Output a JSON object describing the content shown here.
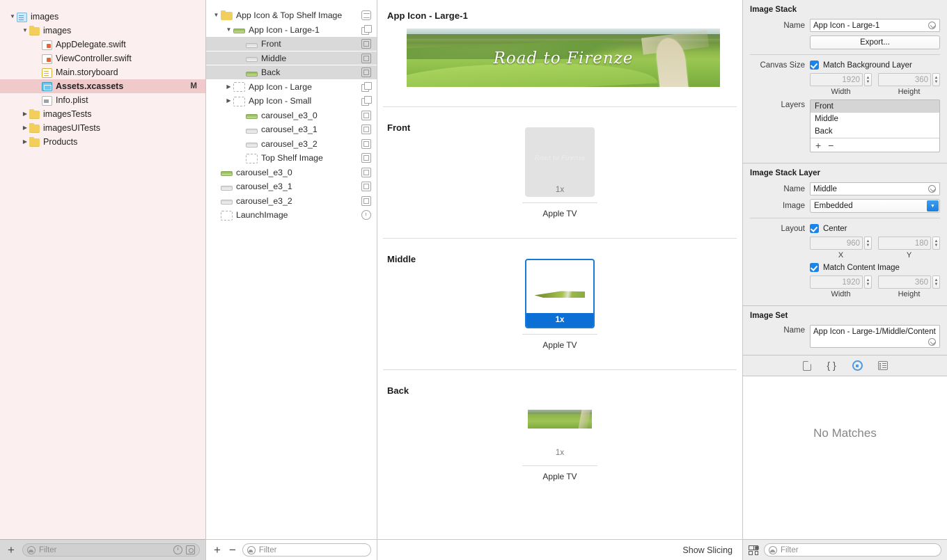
{
  "navigator": {
    "items": [
      {
        "label": "images",
        "indent": 0,
        "disc": "open",
        "icon": "project-icon",
        "selected": false,
        "status": ""
      },
      {
        "label": "images",
        "indent": 1,
        "disc": "open",
        "icon": "folder-icon",
        "selected": false,
        "status": ""
      },
      {
        "label": "AppDelegate.swift",
        "indent": 2,
        "disc": "none",
        "icon": "swift-file-icon",
        "selected": false,
        "status": ""
      },
      {
        "label": "ViewController.swift",
        "indent": 2,
        "disc": "none",
        "icon": "swift-file-icon",
        "selected": false,
        "status": ""
      },
      {
        "label": "Main.storyboard",
        "indent": 2,
        "disc": "none",
        "icon": "storyboard-icon",
        "selected": false,
        "status": ""
      },
      {
        "label": "Assets.xcassets",
        "indent": 2,
        "disc": "none",
        "icon": "assets-icon",
        "selected": true,
        "status": "M"
      },
      {
        "label": "Info.plist",
        "indent": 2,
        "disc": "none",
        "icon": "plist-icon",
        "selected": false,
        "status": ""
      },
      {
        "label": "imagesTests",
        "indent": 1,
        "disc": "closed",
        "icon": "folder-icon",
        "selected": false,
        "status": ""
      },
      {
        "label": "imagesUITests",
        "indent": 1,
        "disc": "closed",
        "icon": "folder-icon",
        "selected": false,
        "status": ""
      },
      {
        "label": "Products",
        "indent": 1,
        "disc": "closed",
        "icon": "folder-icon",
        "selected": false,
        "status": ""
      }
    ],
    "bottom": {
      "add_label": "+",
      "filter_placeholder": "Filter",
      "recent_icon": "clock-icon",
      "focus_icon": "focus-icon"
    }
  },
  "asset_list": {
    "items": [
      {
        "label": "App Icon & Top Shelf Image",
        "indent": 0,
        "disc": "open",
        "thumb": "folder",
        "badge": "globe-badge-icon",
        "selected": false
      },
      {
        "label": "App Icon - Large-1",
        "indent": 1,
        "disc": "open",
        "thumb": "strip-green",
        "badge": "stack-badge-icon",
        "selected": false
      },
      {
        "label": "Front",
        "indent": 2,
        "disc": "none",
        "thumb": "strip-gray",
        "badge": "square-badge-icon",
        "selected": true
      },
      {
        "label": "Middle",
        "indent": 2,
        "disc": "none",
        "thumb": "strip-gray",
        "badge": "square-badge-icon",
        "selected": true
      },
      {
        "label": "Back",
        "indent": 2,
        "disc": "none",
        "thumb": "strip-green",
        "badge": "square-badge-icon",
        "selected": true
      },
      {
        "label": "App Icon - Large",
        "indent": 1,
        "disc": "closed",
        "thumb": "dashed",
        "badge": "stack-badge-icon",
        "selected": false
      },
      {
        "label": "App Icon - Small",
        "indent": 1,
        "disc": "closed",
        "thumb": "dashed",
        "badge": "stack-badge-icon",
        "selected": false
      },
      {
        "label": "carousel_e3_0",
        "indent": 2,
        "disc": "none",
        "thumb": "strip-green",
        "badge": "square-badge-icon",
        "selected": false
      },
      {
        "label": "carousel_e3_1",
        "indent": 2,
        "disc": "none",
        "thumb": "strip-gray",
        "badge": "square-badge-icon",
        "selected": false
      },
      {
        "label": "carousel_e3_2",
        "indent": 2,
        "disc": "none",
        "thumb": "strip-gray",
        "badge": "square-badge-icon",
        "selected": false
      },
      {
        "label": "Top Shelf Image",
        "indent": 2,
        "disc": "none",
        "thumb": "dashed",
        "badge": "square-badge-icon",
        "selected": false
      },
      {
        "label": "carousel_e3_0",
        "indent": 0,
        "disc": "none",
        "thumb": "strip-green",
        "badge": "square-badge-icon",
        "selected": false
      },
      {
        "label": "carousel_e3_1",
        "indent": 0,
        "disc": "none",
        "thumb": "strip-gray",
        "badge": "square-badge-icon",
        "selected": false
      },
      {
        "label": "carousel_e3_2",
        "indent": 0,
        "disc": "none",
        "thumb": "strip-gray",
        "badge": "square-badge-icon",
        "selected": false
      },
      {
        "label": "LaunchImage",
        "indent": 0,
        "disc": "none",
        "thumb": "dashed",
        "badge": "clock-badge-icon",
        "selected": false
      }
    ],
    "bottom": {
      "add_label": "+",
      "remove_label": "−",
      "filter_placeholder": "Filter"
    }
  },
  "editor": {
    "title": "App Icon - Large-1",
    "hero_text": "Road to Firenze",
    "sections": [
      {
        "title": "Front",
        "state": "empty",
        "scale": "1x",
        "device": "Apple TV",
        "ghost_text": "Road to Firenze"
      },
      {
        "title": "Middle",
        "state": "selected",
        "scale": "1x",
        "device": "Apple TV",
        "ghost_text": ""
      },
      {
        "title": "Back",
        "state": "bare",
        "scale": "1x",
        "device": "Apple TV",
        "ghost_text": ""
      }
    ],
    "show_slicing_label": "Show Slicing"
  },
  "inspector": {
    "image_stack": {
      "header": "Image Stack",
      "name_label": "Name",
      "name_value": "App Icon - Large-1",
      "export_label": "Export...",
      "canvas_size_label": "Canvas Size",
      "match_background_label": "Match Background Layer",
      "match_background_checked": true,
      "width_value": "1920",
      "height_value": "360",
      "width_label": "Width",
      "height_label": "Height",
      "layers_label": "Layers",
      "layers": [
        "Front",
        "Middle",
        "Back"
      ],
      "layers_selected": "Front",
      "layers_add": "+",
      "layers_remove": "−"
    },
    "image_stack_layer": {
      "header": "Image Stack Layer",
      "name_label": "Name",
      "name_value": "Middle",
      "image_label": "Image",
      "image_value": "Embedded",
      "layout_label": "Layout",
      "center_label": "Center",
      "center_checked": true,
      "x_value": "960",
      "y_value": "180",
      "x_label": "X",
      "y_label": "Y",
      "match_content_label": "Match Content Image",
      "match_content_checked": true,
      "width_value": "1920",
      "height_value": "360",
      "width_label": "Width",
      "height_label": "Height"
    },
    "image_set": {
      "header": "Image Set",
      "name_label": "Name",
      "name_value": "App Icon - Large-1/Middle/Content"
    },
    "library": {
      "tabs": [
        "file-template-icon",
        "code-snippet-icon",
        "media-library-icon",
        "object-library-icon"
      ],
      "selected_tab": "media-library-icon",
      "empty_message": "No Matches",
      "filter_placeholder": "Filter",
      "grid_icon": "grid-view-icon"
    }
  },
  "colors": {
    "accent_blue": "#0b6fd6",
    "selection_pink": "#f0c9cb",
    "navigator_bg": "#fceff0",
    "inspector_bg": "#ededed"
  }
}
